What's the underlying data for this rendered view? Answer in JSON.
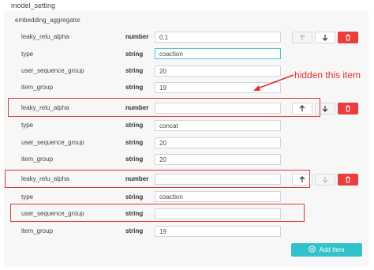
{
  "section_title": "model_setting",
  "subsection_title": "embedding_aggregator",
  "add_button_label": "Add Item",
  "annotation_text": "hidden this item",
  "colors": {
    "accent": "#33c2c9",
    "danger": "#ea3d3d",
    "annotation": "#e0302d"
  },
  "groups": [
    {
      "rows": [
        {
          "name": "leaky_relu_alpha",
          "type": "number",
          "value": "0.1"
        },
        {
          "name": "type",
          "type": "string",
          "value": "coaction"
        },
        {
          "name": "user_sequence_group",
          "type": "string",
          "value": "20"
        },
        {
          "name": "item_group",
          "type": "string",
          "value": "19"
        }
      ]
    },
    {
      "rows": [
        {
          "name": "leaky_relu_alpha",
          "type": "number",
          "value": ""
        },
        {
          "name": "type",
          "type": "string",
          "value": "concat"
        },
        {
          "name": "user_sequence_group",
          "type": "string",
          "value": "20"
        },
        {
          "name": "item_group",
          "type": "string",
          "value": "20"
        }
      ]
    },
    {
      "rows": [
        {
          "name": "leaky_relu_alpha",
          "type": "number",
          "value": ""
        },
        {
          "name": "type",
          "type": "string",
          "value": "coaction"
        },
        {
          "name": "user_sequence_group",
          "type": "string",
          "value": ""
        },
        {
          "name": "item_group",
          "type": "string",
          "value": "19"
        }
      ]
    }
  ]
}
